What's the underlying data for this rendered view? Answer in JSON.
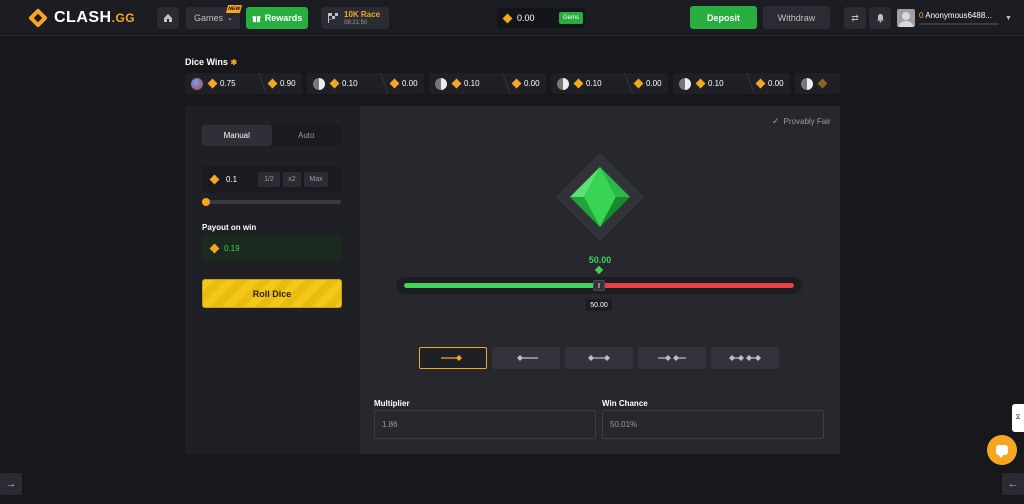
{
  "header": {
    "logo_text": "CLASH",
    "logo_suffix": ".GG",
    "games_label": "Games",
    "games_badge": "NEW",
    "rewards_label": "Rewards",
    "race_title": "10K Race",
    "race_timer": "08:21:50",
    "balance": "0.00",
    "gems_label": "Gems",
    "deposit_label": "Deposit",
    "withdraw_label": "Withdraw",
    "user_balance": "0",
    "username": "Anonymous6488..."
  },
  "dice_wins": {
    "title": "Dice Wins",
    "items": [
      {
        "bet": "0.75",
        "payout": "0.90"
      },
      {
        "bet": "0.10",
        "payout": "0.00"
      },
      {
        "bet": "0.10",
        "payout": "0.00"
      },
      {
        "bet": "0.10",
        "payout": "0.00"
      },
      {
        "bet": "0.10",
        "payout": "0.00"
      }
    ]
  },
  "controls": {
    "tab_manual": "Manual",
    "tab_auto": "Auto",
    "bet_amount": "0.1",
    "half_label": "1/2",
    "double_label": "x2",
    "max_label": "Max",
    "bet_slider_fraction": 0.0,
    "payout_label": "Payout on win",
    "payout_value": "0.19",
    "roll_label": "Roll Dice"
  },
  "game": {
    "provably_fair": "Provably Fair",
    "target_value": "50.00",
    "slider_value": "50.00",
    "slider_fraction": 0.5,
    "win_color": "#44d35d",
    "lose_color": "#e84141",
    "modes": [
      "roll-over",
      "roll-under",
      "between",
      "outside",
      "between-two"
    ],
    "active_mode": 0,
    "multiplier_label": "Multiplier",
    "multiplier_value": "1.86",
    "win_chance_label": "Win Chance",
    "win_chance_value": "50.01%"
  },
  "colors": {
    "accent": "#f5a623",
    "green": "#27ae3f"
  }
}
